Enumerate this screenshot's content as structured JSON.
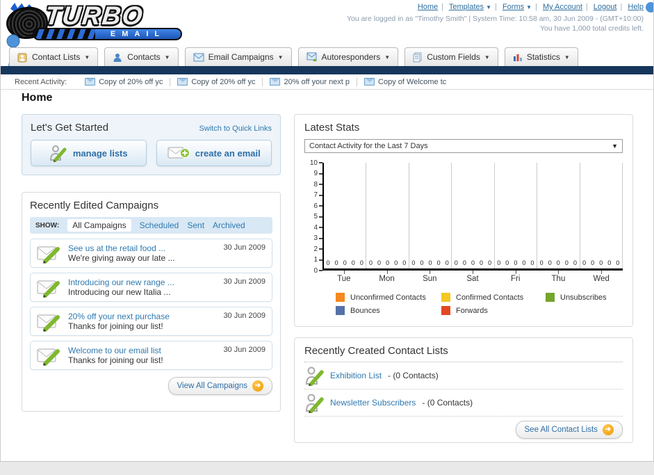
{
  "header": {
    "logo_line1": "TURBO",
    "logo_line2": "EMAIL",
    "nav": [
      {
        "label": "Home",
        "dropdown": false
      },
      {
        "label": "Templates",
        "dropdown": true
      },
      {
        "label": "Forms",
        "dropdown": true
      },
      {
        "label": "My Account",
        "dropdown": false
      },
      {
        "label": "Logout",
        "dropdown": false
      },
      {
        "label": "Help",
        "dropdown": false
      }
    ],
    "login_info": "You are logged in as \"Timothy Smith\" | System Time: 10:58 am, 30 Jun 2009 - (GMT+10:00)",
    "credits_info": "You have 1,000 total credits left."
  },
  "tabs": [
    {
      "label": "Contact Lists",
      "icon": "address-book-icon"
    },
    {
      "label": "Contacts",
      "icon": "person-icon"
    },
    {
      "label": "Email Campaigns",
      "icon": "envelope-icon"
    },
    {
      "label": "Autoresponders",
      "icon": "envelope-reply-icon"
    },
    {
      "label": "Custom Fields",
      "icon": "form-pages-icon"
    },
    {
      "label": "Statistics",
      "icon": "bar-chart-icon"
    }
  ],
  "recent_activity": {
    "label": "Recent Activity:",
    "items": [
      "Copy of 20% off yc",
      "Copy of 20% off yc",
      "20% off your next p",
      "Copy of Welcome tc"
    ]
  },
  "page_title": "Home",
  "get_started": {
    "title": "Let's Get Started",
    "switch_link": "Switch to Quick Links",
    "manage_lists_label": "manage lists",
    "create_email_label": "create an email"
  },
  "campaigns_panel": {
    "title": "Recently Edited Campaigns",
    "show_label": "SHOW:",
    "filters": [
      "All Campaigns",
      "Scheduled",
      "Sent",
      "Archived"
    ],
    "active_filter": "All Campaigns",
    "items": [
      {
        "title": "See us at the retail food ...",
        "subtitle": "We're giving away our late ...",
        "date": "30 Jun 2009"
      },
      {
        "title": "Introducing our new range ...",
        "subtitle": "Introducing our new Italia ...",
        "date": "30 Jun 2009"
      },
      {
        "title": "20% off your next purchase",
        "subtitle": "Thanks for joining our list!",
        "date": "30 Jun 2009"
      },
      {
        "title": "Welcome to our email list",
        "subtitle": "Thanks for joining our list!",
        "date": "30 Jun 2009"
      }
    ],
    "view_all_label": "View All Campaigns"
  },
  "stats_panel": {
    "title": "Latest Stats",
    "selected_report": "Contact Activity for the Last 7 Days"
  },
  "chart_data": {
    "type": "bar",
    "title": "Contact Activity for the Last 7 Days",
    "categories": [
      "Tue",
      "Mon",
      "Sun",
      "Sat",
      "Fri",
      "Thu",
      "Wed"
    ],
    "series": [
      {
        "name": "Unconfirmed Contacts",
        "color": "#F6891F",
        "values": [
          0,
          0,
          0,
          0,
          0,
          0,
          0
        ]
      },
      {
        "name": "Confirmed Contacts",
        "color": "#F5C721",
        "values": [
          0,
          0,
          0,
          0,
          0,
          0,
          0
        ]
      },
      {
        "name": "Unsubscribes",
        "color": "#74A52C",
        "values": [
          0,
          0,
          0,
          0,
          0,
          0,
          0
        ]
      },
      {
        "name": "Bounces",
        "color": "#5571A7",
        "values": [
          0,
          0,
          0,
          0,
          0,
          0,
          0
        ]
      },
      {
        "name": "Forwards",
        "color": "#E24922",
        "values": [
          0,
          0,
          0,
          0,
          0,
          0,
          0
        ]
      }
    ],
    "ylim": [
      0,
      10
    ],
    "ytick_step": 1,
    "grid": "vertical",
    "legend_position": "bottom",
    "value_labels": true
  },
  "contact_lists_panel": {
    "title": "Recently Created Contact Lists",
    "items": [
      {
        "name": "Exhibition List",
        "count": "- (0 Contacts)"
      },
      {
        "name": "Newsletter Subscribers",
        "count": "- (0 Contacts)"
      }
    ],
    "see_all_label": "See All Contact Lists"
  },
  "colors": {
    "navy_bar": "#16365C",
    "link_blue": "#2E79AE",
    "button_text_blue": "#2F6FA7",
    "go_button_orange": "#EF9A05",
    "pencil_green": "#7FB82E"
  }
}
